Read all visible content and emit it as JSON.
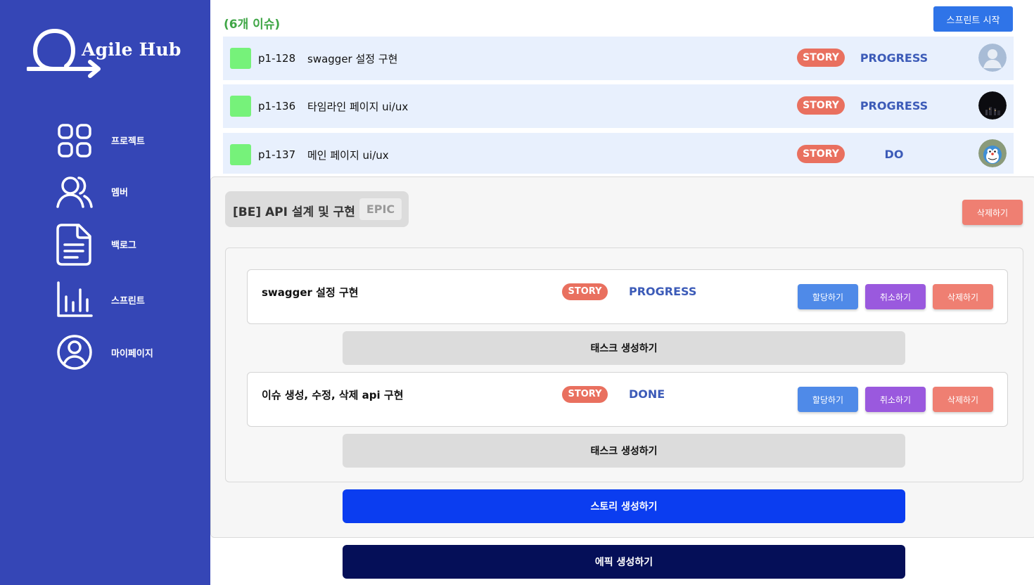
{
  "brand": {
    "name": "Agile Hub",
    "logo_icon": "agile-hub-logo-icon"
  },
  "sidebar": {
    "items": [
      {
        "label": "프로젝트",
        "icon": "grid-icon"
      },
      {
        "label": "멤버",
        "icon": "users-icon"
      },
      {
        "label": "백로그",
        "icon": "document-icon"
      },
      {
        "label": "스프린트",
        "icon": "bar-chart-icon"
      },
      {
        "label": "마이페이지",
        "icon": "user-circle-icon"
      }
    ]
  },
  "sprint": {
    "issue_count": "(6개 이슈)",
    "start_button": "스프린트 시작",
    "issues": [
      {
        "key": "p1-128",
        "title": "swagger 설정 구현",
        "type": "STORY",
        "status": "PROGRESS",
        "avatar": "default-avatar"
      },
      {
        "key": "p1-136",
        "title": "타임라인 페이지 ui/ux",
        "type": "STORY",
        "status": "PROGRESS",
        "avatar": "dark-avatar"
      },
      {
        "key": "p1-137",
        "title": "메인 페이지 ui/ux",
        "type": "STORY",
        "status": "DO",
        "avatar": "cartoon-avatar"
      }
    ]
  },
  "epic": {
    "title": "[BE] API 설계 및 구현",
    "badge": "EPIC",
    "delete_button": "삭제하기",
    "stories": [
      {
        "title": "swagger 설정 구현",
        "type": "STORY",
        "status": "PROGRESS",
        "assign": "할당하기",
        "cancel": "취소하기",
        "delete": "삭제하기",
        "task_button": "태스크 생성하기"
      },
      {
        "title": "이슈 생성, 수정, 삭제 api 구현",
        "type": "STORY",
        "status": "DONE",
        "assign": "할당하기",
        "cancel": "취소하기",
        "delete": "삭제하기",
        "task_button": "태스크 생성하기"
      }
    ],
    "story_create_button": "스토리 생성하기"
  },
  "epic_create_button": "에픽 생성하기",
  "colors": {
    "sidebar": "#3546b6",
    "issue_count": "#3fa646",
    "primary": "#2f74e8",
    "story_pill": "#e9705f",
    "status": "#3c5bb8",
    "issue_row": "#e8f0fd",
    "assign": "#4f8ae8",
    "cancel": "#9a59de",
    "delete": "#ef7f72",
    "story_create": "#0b3df0",
    "epic_create": "#050f58"
  }
}
